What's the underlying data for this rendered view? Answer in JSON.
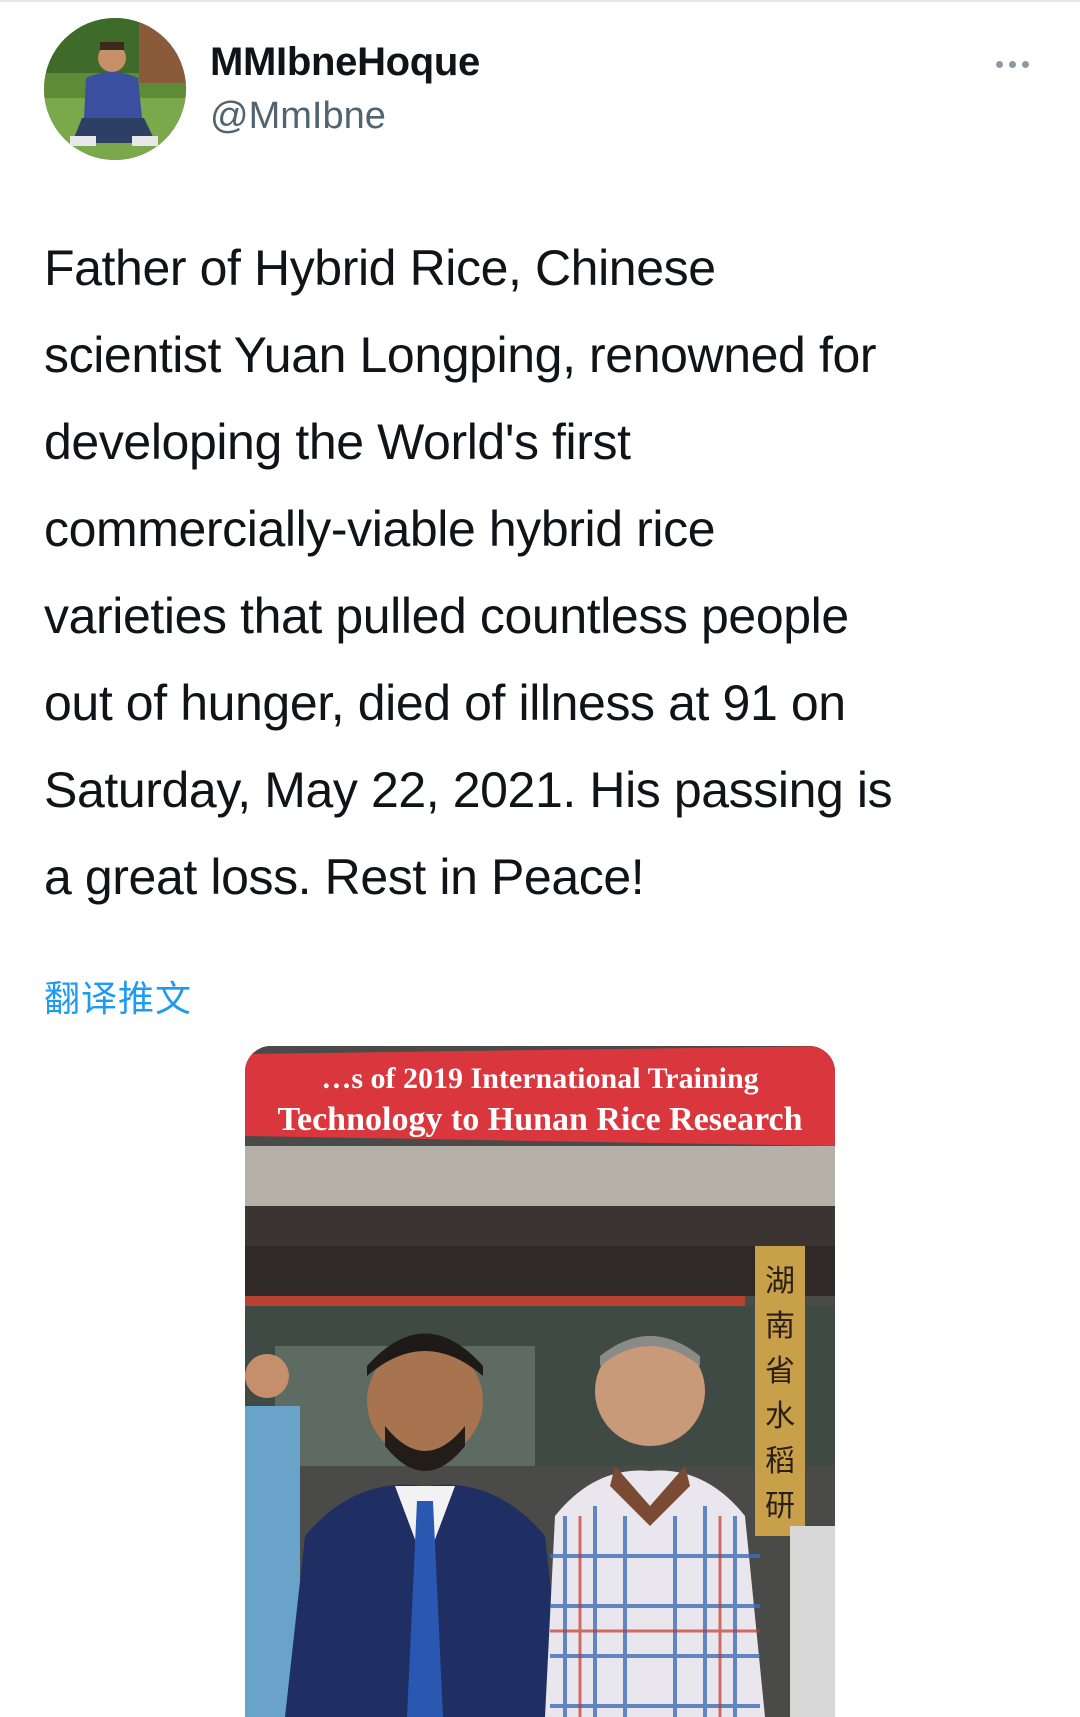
{
  "tweet": {
    "author": {
      "display_name": "MMIbneHoque",
      "handle": "@MmIbne",
      "avatar_icon": "avatar-photo"
    },
    "more_icon": "more-horizontal-icon",
    "text_lines": [
      "Father of Hybrid Rice, Chinese",
      "scientist Yuan Longping, renowned for",
      "developing the World's first",
      "commercially-viable hybrid rice",
      "varieties that pulled countless people",
      "out of hunger, died of illness at 91 on",
      "Saturday, May 22, 2021. His passing is",
      "a great loss. Rest in Peace!"
    ],
    "translate_label": "翻译推文",
    "media": {
      "banner_line1": "…s of 2019 International Training",
      "banner_line2": "Technology to Hunan Rice Research",
      "vertical_sign": "湖南省水稻研"
    }
  },
  "colors": {
    "text": "#0f1419",
    "secondary": "#536471",
    "link": "#1d9bf0",
    "banner": "#d9363e"
  }
}
